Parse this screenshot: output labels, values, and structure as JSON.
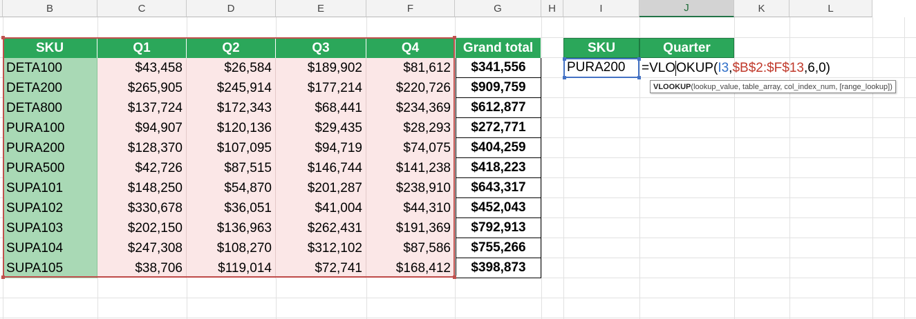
{
  "columns": [
    {
      "letter": "B",
      "active": false
    },
    {
      "letter": "C",
      "active": false
    },
    {
      "letter": "D",
      "active": false
    },
    {
      "letter": "E",
      "active": false
    },
    {
      "letter": "F",
      "active": false
    },
    {
      "letter": "G",
      "active": false
    },
    {
      "letter": "H",
      "active": false
    },
    {
      "letter": "I",
      "active": false
    },
    {
      "letter": "J",
      "active": true
    },
    {
      "letter": "K",
      "active": false
    },
    {
      "letter": "L",
      "active": false
    }
  ],
  "table": {
    "headers": [
      "SKU",
      "Q1",
      "Q2",
      "Q3",
      "Q4",
      "Grand total"
    ],
    "rows": [
      [
        "DETA100",
        "$43,458",
        "$26,584",
        "$189,902",
        "$81,612",
        "$341,556"
      ],
      [
        "DETA200",
        "$265,905",
        "$245,914",
        "$177,214",
        "$220,726",
        "$909,759"
      ],
      [
        "DETA800",
        "$137,724",
        "$172,343",
        "$68,441",
        "$234,369",
        "$612,877"
      ],
      [
        "PURA100",
        "$94,907",
        "$120,136",
        "$29,435",
        "$28,293",
        "$272,771"
      ],
      [
        "PURA200",
        "$128,370",
        "$107,095",
        "$94,719",
        "$74,075",
        "$404,259"
      ],
      [
        "PURA500",
        "$42,726",
        "$87,515",
        "$146,744",
        "$141,238",
        "$418,223"
      ],
      [
        "SUPA101",
        "$148,250",
        "$54,870",
        "$201,287",
        "$238,910",
        "$643,317"
      ],
      [
        "SUPA102",
        "$330,678",
        "$36,051",
        "$41,004",
        "$44,310",
        "$452,043"
      ],
      [
        "SUPA103",
        "$202,150",
        "$136,963",
        "$262,431",
        "$191,369",
        "$792,913"
      ],
      [
        "SUPA104",
        "$247,308",
        "$108,270",
        "$312,102",
        "$87,586",
        "$755,266"
      ],
      [
        "SUPA105",
        "$38,706",
        "$119,014",
        "$72,741",
        "$168,412",
        "$398,873"
      ]
    ]
  },
  "lookup": {
    "headers": [
      "SKU",
      "Quarter"
    ],
    "sku_value": "PURA200",
    "formula": {
      "prefix": "=VLO",
      "rest": "OKUP(",
      "arg1": "I3",
      "comma1": ",",
      "arg2": "$B$2:$F$13",
      "tail": ",6,0)"
    }
  },
  "tooltip": {
    "func": "VLOOKUP",
    "args": "(lookup_value, table_array, col_index_num, [range_lookup])"
  },
  "colors": {
    "header_green": "#2ba75a",
    "sku_green": "#a9d9b5",
    "value_pink": "#fbe7e7",
    "copy_range_red": "#c0504d",
    "selection_blue": "#4472c4"
  }
}
